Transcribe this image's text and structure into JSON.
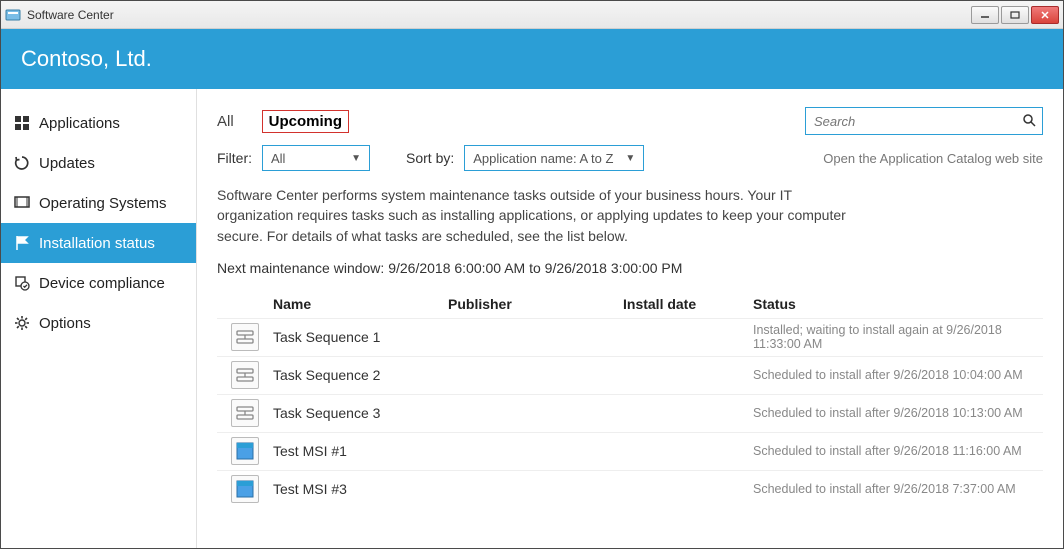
{
  "window": {
    "title": "Software Center"
  },
  "brand": {
    "org": "Contoso, Ltd."
  },
  "sidebar": {
    "items": [
      {
        "label": "Applications",
        "icon": "apps"
      },
      {
        "label": "Updates",
        "icon": "refresh"
      },
      {
        "label": "Operating Systems",
        "icon": "os"
      },
      {
        "label": "Installation status",
        "icon": "flag",
        "active": true
      },
      {
        "label": "Device compliance",
        "icon": "compliance"
      },
      {
        "label": "Options",
        "icon": "gear"
      }
    ]
  },
  "tabs": {
    "all": "All",
    "upcoming": "Upcoming"
  },
  "search": {
    "placeholder": "Search"
  },
  "filter": {
    "label": "Filter:",
    "selected": "All"
  },
  "sort": {
    "label": "Sort by:",
    "selected": "Application name: A to Z"
  },
  "link": {
    "catalog": "Open the Application Catalog web site"
  },
  "description": "Software Center performs system maintenance tasks outside of your business hours. Your IT organization requires tasks such as installing applications, or applying updates to keep your computer secure. For details of what tasks are scheduled, see the list below.",
  "maintenance_window": "Next maintenance window: 9/26/2018 6:00:00 AM to 9/26/2018 3:00:00 PM",
  "columns": {
    "name": "Name",
    "publisher": "Publisher",
    "install_date": "Install date",
    "status": "Status"
  },
  "rows": [
    {
      "icon": "tasksequence",
      "name": "Task Sequence 1",
      "publisher": "",
      "install_date": "",
      "status": "Installed; waiting to install again at 9/26/2018 11:33:00 AM"
    },
    {
      "icon": "tasksequence",
      "name": "Task Sequence 2",
      "publisher": "",
      "install_date": "",
      "status": "Scheduled to install after 9/26/2018 10:04:00 AM"
    },
    {
      "icon": "tasksequence",
      "name": "Task Sequence 3",
      "publisher": "",
      "install_date": "",
      "status": "Scheduled to install after 9/26/2018 10:13:00 AM"
    },
    {
      "icon": "msi",
      "name": "Test MSI #1",
      "publisher": "",
      "install_date": "",
      "status": "Scheduled to install after 9/26/2018 11:16:00 AM"
    },
    {
      "icon": "msi",
      "name": "Test MSI #3",
      "publisher": "",
      "install_date": "",
      "status": "Scheduled to install after 9/26/2018 7:37:00 AM"
    }
  ]
}
